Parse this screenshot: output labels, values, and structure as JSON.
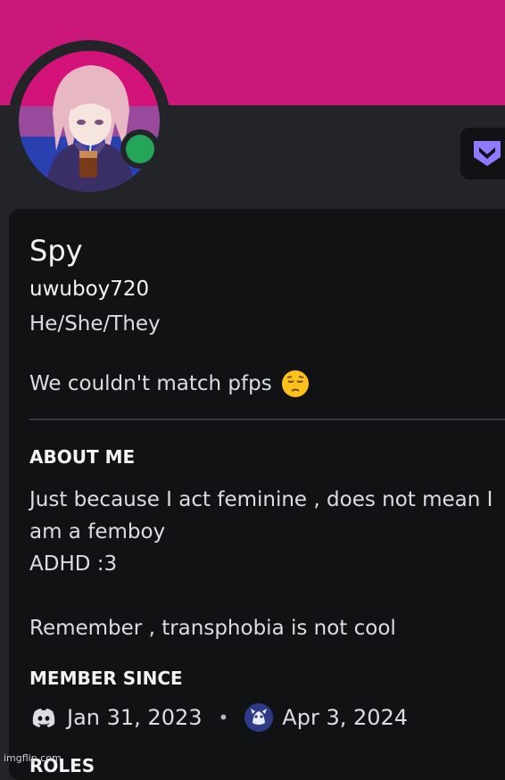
{
  "colors": {
    "banner": "#c9187a",
    "status_online": "#23a55a",
    "badge_accent": "#8f7aff"
  },
  "profile": {
    "display_name": "Spy",
    "username": "uwuboy720",
    "pronouns": "He/She/They",
    "custom_status": "We couldn't match pfps",
    "status_emoji": "pensive-face-icon"
  },
  "about": {
    "heading": "ABOUT ME",
    "lines": [
      "Just because I act feminine , does not mean I",
      "am a femboy",
      "ADHD :3",
      "",
      "Remember , transphobia is not cool"
    ]
  },
  "member_since": {
    "heading": "MEMBER SINCE",
    "discord_icon": "discord-icon",
    "discord_date": "Jan 31, 2023",
    "separator": "•",
    "server_icon": "server-icon",
    "server_date": "Apr 3, 2024"
  },
  "roles": {
    "heading": "ROLES"
  },
  "watermark": "imgflip.com"
}
